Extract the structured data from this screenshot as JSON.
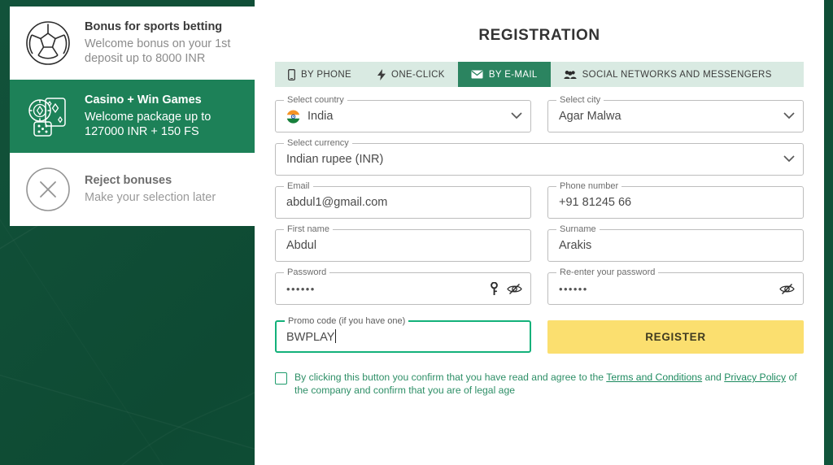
{
  "theme": {
    "brand_green": "#1d8158",
    "tab_active_green": "#2b8460",
    "tab_bar_green": "#d9eae2",
    "backdrop_green": "#12523a",
    "register_yellow": "#fbdf6f",
    "focus_green": "#13b17a",
    "terms_green": "#2e8f67"
  },
  "bonus_panel": {
    "cards": [
      {
        "icon": "soccer-ball-icon",
        "title": "Bonus for sports betting",
        "subtitle": "Welcome bonus on your 1st deposit up to 8000 INR",
        "selected": false
      },
      {
        "icon": "casino-chips-cards-icon",
        "title": "Casino + Win Games",
        "subtitle": "Welcome package up to 127000 INR + 150 FS",
        "selected": true
      },
      {
        "icon": "reject-circle-x-icon",
        "title": "Reject bonuses",
        "subtitle": "Make your selection later",
        "selected": false
      }
    ]
  },
  "form": {
    "title": "REGISTRATION",
    "tabs": [
      {
        "label": "BY PHONE",
        "icon": "phone-icon",
        "active": false
      },
      {
        "label": "ONE-CLICK",
        "icon": "lightning-bolt-icon",
        "active": false
      },
      {
        "label": "BY E-MAIL",
        "icon": "envelope-icon",
        "active": true
      },
      {
        "label": "SOCIAL NETWORKS AND MESSENGERS",
        "icon": "people-group-icon",
        "active": false
      }
    ],
    "fields": {
      "country": {
        "label": "Select country",
        "value": "India",
        "flag": "india-flag-icon"
      },
      "city": {
        "label": "Select city",
        "value": "Agar Malwa"
      },
      "currency": {
        "label": "Select currency",
        "value": "Indian rupee (INR)"
      },
      "email": {
        "label": "Email",
        "value": "abdul1@gmail.com"
      },
      "phone": {
        "label": "Phone number",
        "value": "+91  81245 66"
      },
      "first_name": {
        "label": "First name",
        "value": "Abdul"
      },
      "surname": {
        "label": "Surname",
        "value": "Arakis"
      },
      "password": {
        "label": "Password",
        "value": "••••••"
      },
      "password_repeat": {
        "label": "Re-enter your password",
        "value": "••••••"
      },
      "promo": {
        "label": "Promo code (if you have one)",
        "value": "BWPLAY",
        "focused": true
      }
    },
    "register_label": "REGISTER",
    "terms": {
      "part1": "By clicking this button you confirm that you have read and agree to the ",
      "link1": "Terms and Conditions",
      "mid": " and ",
      "link2": "Privacy Policy",
      "part2": " of the company and confirm that you are of legal age",
      "checked": false
    }
  }
}
